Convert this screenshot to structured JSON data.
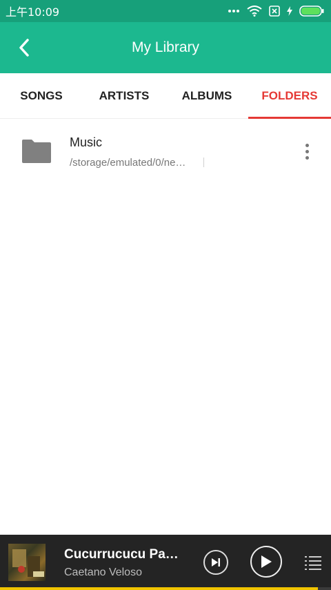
{
  "status_bar": {
    "time": "上午10:09",
    "icons": [
      "more-dots-icon",
      "wifi-icon",
      "no-sim-icon",
      "charging-icon",
      "battery-icon"
    ],
    "battery_color": "#5de05d"
  },
  "toolbar": {
    "title": "My Library",
    "back_icon": "chevron-left-icon",
    "color": "#1cb88f"
  },
  "tabs": [
    {
      "label": "SONGS",
      "active": false
    },
    {
      "label": "ARTISTS",
      "active": false
    },
    {
      "label": "ALBUMS",
      "active": false
    },
    {
      "label": "FOLDERS",
      "active": true
    }
  ],
  "accent_color": "#e53935",
  "folders": [
    {
      "name": "Music",
      "path": "/storage/emulated/0/ne…",
      "icon": "folder-icon",
      "menu_icon": "more-vert-icon"
    }
  ],
  "now_playing": {
    "title": "Cucurrucucu Pa…",
    "artist": "Caetano Veloso",
    "progress": 0.96,
    "progress_color": "#f0c400",
    "controls": [
      "skip-next-icon",
      "play-icon",
      "queue-list-icon"
    ]
  }
}
